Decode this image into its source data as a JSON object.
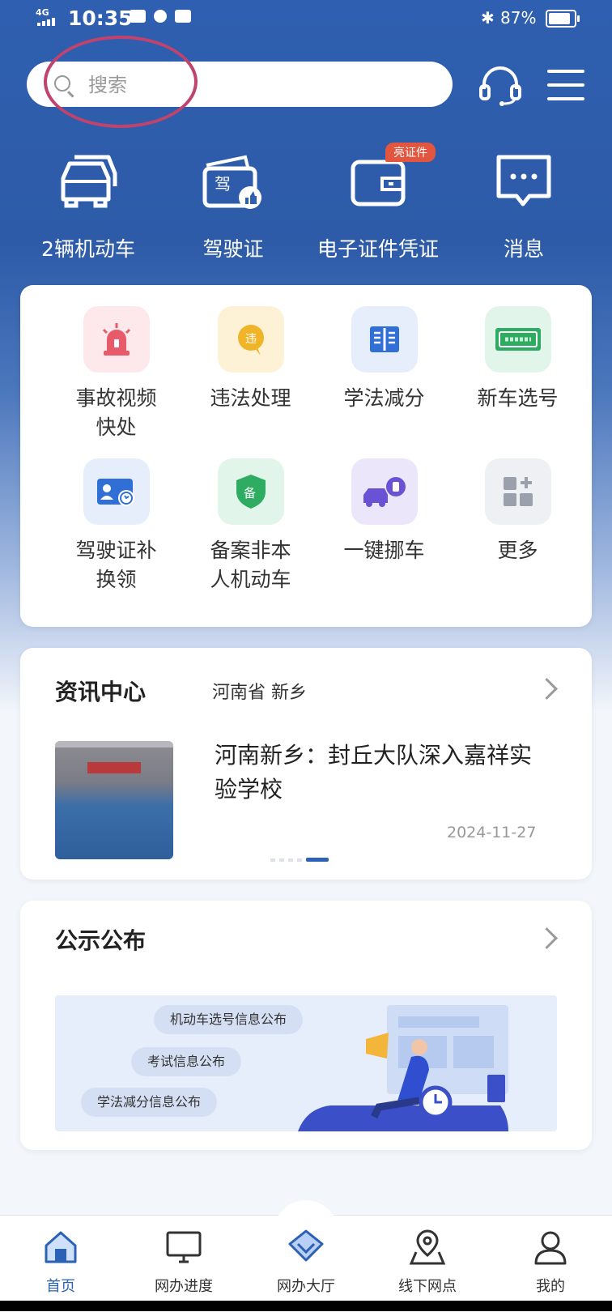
{
  "status_bar": {
    "network": "4G",
    "time": "10:35",
    "battery": "87%"
  },
  "search": {
    "placeholder": "搜索"
  },
  "quick_links": [
    {
      "label": "2辆机动车",
      "icon": "car-icon"
    },
    {
      "label": "驾驶证",
      "icon": "license-icon"
    },
    {
      "label": "电子证件凭证",
      "icon": "wallet-icon",
      "badge": "亮证件"
    },
    {
      "label": "消息",
      "icon": "message-icon"
    }
  ],
  "services": [
    {
      "label_lines": [
        "事故视频",
        "快处"
      ],
      "icon": "siren-icon"
    },
    {
      "label_lines": [
        "违法处理"
      ],
      "icon": "violation-icon"
    },
    {
      "label_lines": [
        "学法减分"
      ],
      "icon": "book-icon"
    },
    {
      "label_lines": [
        "新车选号"
      ],
      "icon": "plate-icon"
    },
    {
      "label_lines": [
        "驾驶证补",
        "换领"
      ],
      "icon": "id-card-icon"
    },
    {
      "label_lines": [
        "备案非本",
        "人机动车"
      ],
      "icon": "shield-icon"
    },
    {
      "label_lines": [
        "一键挪车"
      ],
      "icon": "move-car-icon"
    },
    {
      "label_lines": [
        "更多"
      ],
      "icon": "more-apps-icon"
    }
  ],
  "news": {
    "title": "资讯中心",
    "location": "河南省 新乡",
    "headline": "河南新乡：封丘大队深入嘉祥实验学校",
    "date": "2024-11-27"
  },
  "notice": {
    "title": "公示公布",
    "pills": [
      "机动车选号信息公布",
      "考试信息公布",
      "学法减分信息公布"
    ]
  },
  "tabbar": [
    {
      "label": "首页",
      "icon": "home-icon",
      "active": true
    },
    {
      "label": "网办进度",
      "icon": "monitor-icon",
      "active": false
    },
    {
      "label": "网办大厅",
      "icon": "hall-icon",
      "active": false
    },
    {
      "label": "线下网点",
      "icon": "location-icon",
      "active": false
    },
    {
      "label": "我的",
      "icon": "user-icon",
      "active": false
    }
  ],
  "colors": {
    "primary": "#2f5fb0",
    "annotation": "#c0436e",
    "badge": "#e2563f"
  }
}
